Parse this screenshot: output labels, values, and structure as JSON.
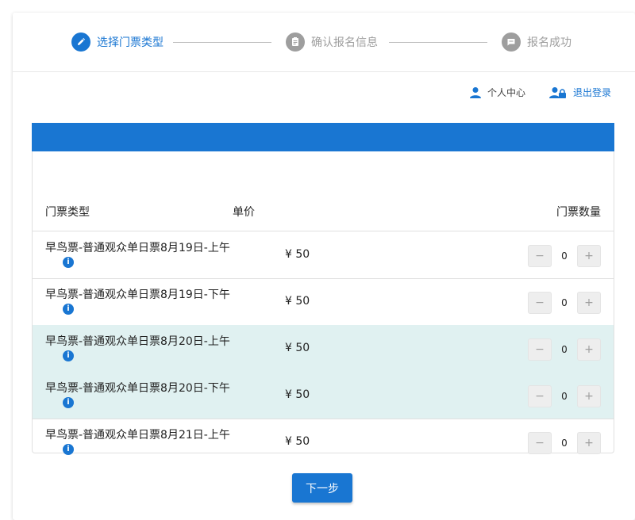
{
  "colors": {
    "primary": "#1976d2",
    "inactive": "#9e9e9e",
    "shaded_row": "#e0f1f1"
  },
  "steps": [
    {
      "label": "选择门票类型",
      "icon": "pencil-icon",
      "state": "active"
    },
    {
      "label": "确认报名信息",
      "icon": "clipboard-icon",
      "state": "inactive"
    },
    {
      "label": "报名成功",
      "icon": "message-icon",
      "state": "inactive"
    }
  ],
  "userbar": {
    "profile_label": "个人中心",
    "logout_label": "退出登录"
  },
  "table": {
    "headers": {
      "type": "门票类型",
      "price": "单价",
      "quantity": "门票数量"
    },
    "rows": [
      {
        "name": "早鸟票-普通观众单日票8月19日-上午",
        "price": "¥ 50",
        "qty": "0",
        "shaded": false
      },
      {
        "name": "早鸟票-普通观众单日票8月19日-下午",
        "price": "¥ 50",
        "qty": "0",
        "shaded": false
      },
      {
        "name": "早鸟票-普通观众单日票8月20日-上午",
        "price": "¥ 50",
        "qty": "0",
        "shaded": true
      },
      {
        "name": "早鸟票-普通观众单日票8月20日-下午",
        "price": "¥ 50",
        "qty": "0",
        "shaded": true
      },
      {
        "name": "早鸟票-普通观众单日票8月21日-上午",
        "price": "¥ 50",
        "qty": "0",
        "shaded": false
      }
    ],
    "minus": "−",
    "plus": "+",
    "info_glyph": "i"
  },
  "next_button": "下一步"
}
